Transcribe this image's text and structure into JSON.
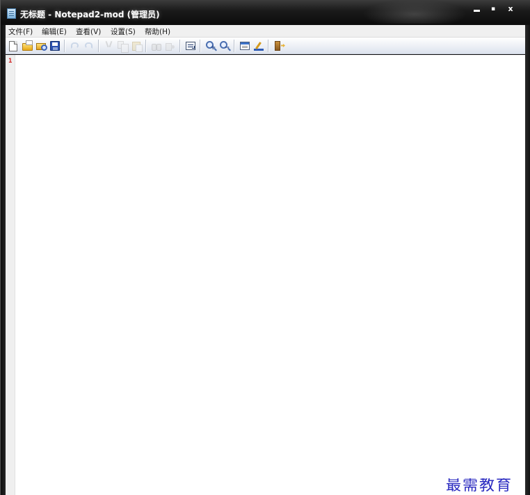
{
  "window": {
    "title": "无标题 - Notepad2-mod (管理员)",
    "caption_buttons": {
      "minimize": "",
      "maximize": "▪",
      "close": "x"
    }
  },
  "menubar": {
    "items": [
      {
        "label": "文件(F)"
      },
      {
        "label": "编辑(E)"
      },
      {
        "label": "查看(V)"
      },
      {
        "label": "设置(S)"
      },
      {
        "label": "帮助(H)"
      }
    ]
  },
  "toolbar": {
    "buttons": [
      {
        "icon": "new-file-icon",
        "enabled": true
      },
      {
        "icon": "open-folder-icon",
        "enabled": true
      },
      {
        "icon": "browse-icon",
        "enabled": true
      },
      {
        "icon": "save-icon",
        "enabled": true
      },
      {
        "icon": "undo-icon",
        "enabled": false
      },
      {
        "icon": "redo-icon",
        "enabled": false
      },
      {
        "icon": "cut-icon",
        "enabled": false
      },
      {
        "icon": "copy-icon",
        "enabled": false
      },
      {
        "icon": "paste-icon",
        "enabled": false
      },
      {
        "icon": "find-icon",
        "enabled": false
      },
      {
        "icon": "replace-icon",
        "enabled": false
      },
      {
        "icon": "word-wrap-icon",
        "enabled": true
      },
      {
        "icon": "zoom-in-icon",
        "enabled": true
      },
      {
        "icon": "zoom-out-icon",
        "enabled": true
      },
      {
        "icon": "settings-icon",
        "enabled": true
      },
      {
        "icon": "scheme-icon",
        "enabled": true
      },
      {
        "icon": "exit-icon",
        "enabled": true
      }
    ],
    "zoom_in_glyph": "+",
    "zoom_out_glyph": "−"
  },
  "editor": {
    "line_numbers": [
      "1"
    ],
    "content": ""
  },
  "watermark": {
    "text": "最需教育"
  },
  "colors": {
    "line_number": "#d02020",
    "watermark": "#2a2ac0",
    "titlebar": "#1a1a1a"
  }
}
